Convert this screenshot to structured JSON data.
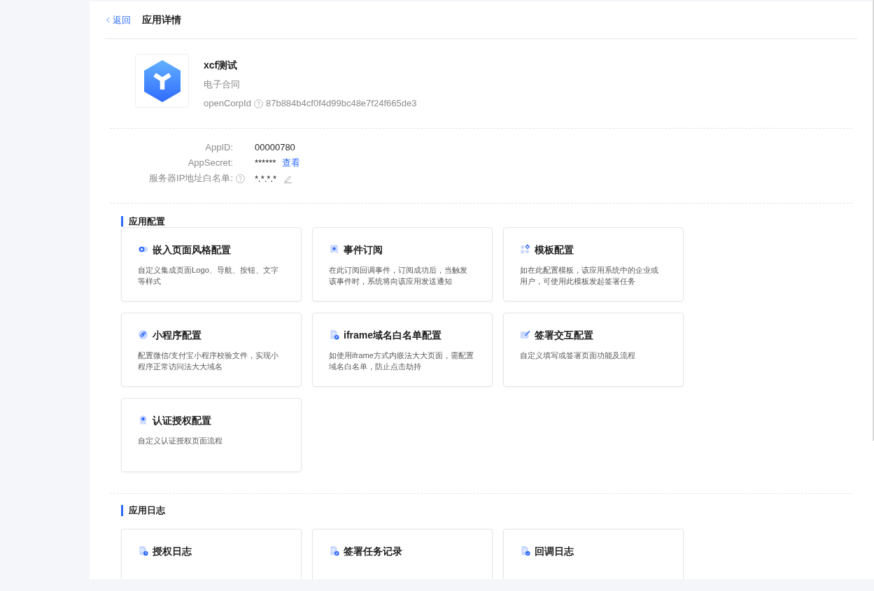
{
  "header": {
    "back": "返回",
    "title": "应用详情"
  },
  "app": {
    "name": "xcf测试",
    "category": "电子合同",
    "corp_id_label": "openCorpId",
    "corp_id": "87b884b4cf0f4d99bc48e7f24f665de3"
  },
  "credentials": [
    {
      "label": "AppID:",
      "help": false,
      "value": "00000780",
      "editable": false
    },
    {
      "label": "AppSecret:",
      "help": false,
      "value": "******",
      "action": "查看",
      "editable": false
    },
    {
      "label": "服务器IP地址白名单:",
      "help": true,
      "value": "*.*.*.*",
      "editable": true
    }
  ],
  "sections": [
    {
      "title": "应用配置",
      "cards": [
        {
          "title": "嵌入页面风格配置",
          "description": "自定义集成页面Logo、导航、按钮、文字等样式"
        },
        {
          "title": "事件订阅",
          "description": "在此订阅回调事件，订阅成功后，当触发该事件时，系统将向该应用发送通知"
        },
        {
          "title": "模板配置",
          "description": "如在此配置模板，该应用系统中的企业或用户，可使用此模板发起签署任务"
        },
        {
          "title": "小程序配置",
          "description": "配置微信/支付宝小程序校验文件，实现小程序正常访问法大大域名"
        },
        {
          "title": "iframe域名白名单配置",
          "description": "如使用iframe方式内嵌法大大页面，需配置域名白名单，防止点击劫持"
        },
        {
          "title": "签署交互配置",
          "description": "自定义填写或签署页面功能及流程"
        },
        {
          "title": "认证授权配置",
          "description": "自定义认证授权页面流程"
        }
      ]
    },
    {
      "title": "应用日志",
      "cards": [
        {
          "title": "授权日志"
        },
        {
          "title": "签署任务记录"
        },
        {
          "title": "回调日志"
        }
      ]
    }
  ]
}
